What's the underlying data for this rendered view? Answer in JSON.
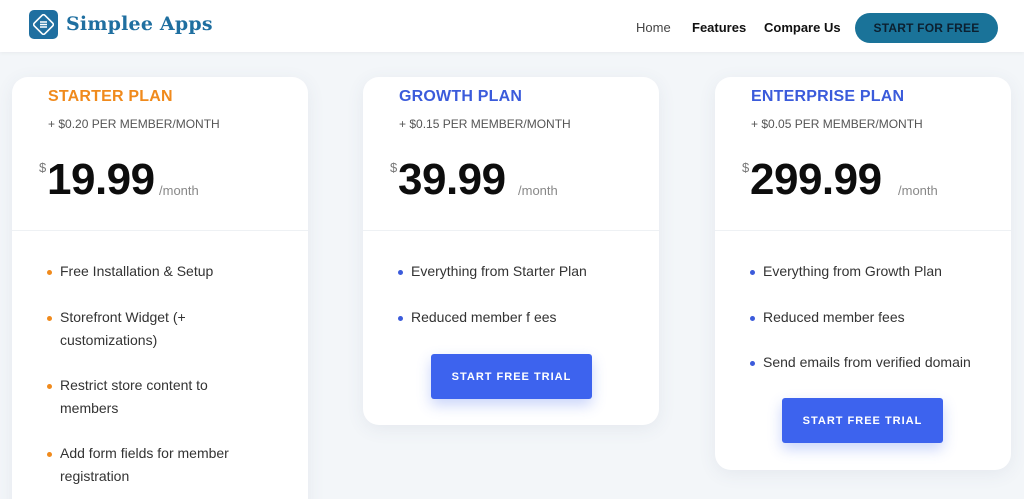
{
  "header": {
    "logo_text": "Simplee Apps",
    "nav": [
      "Home",
      "Features",
      "Compare Us"
    ],
    "cta_label": "START FOR FREE"
  },
  "plans": [
    {
      "name": "STARTER PLAN",
      "fee": "+ $0.20 PER MEMBER/MONTH",
      "currency": "$",
      "price": "19.99",
      "period": "/month",
      "features": [
        "Free Installation & Setup",
        "Storefront Widget (+",
        "customizations)",
        "Restrict store content to",
        "members",
        "Add form fields for member",
        "registration"
      ]
    },
    {
      "name": "GROWTH PLAN",
      "fee": "+ $0.15 PER MEMBER/MONTH",
      "currency": "$",
      "price": "39.99",
      "period": "/month",
      "features": [
        "Everything from Starter Plan",
        "Reduced member f ees"
      ],
      "cta_label": "START FREE TRIAL"
    },
    {
      "name": "ENTERPRISE PLAN",
      "fee": "+ $0.05 PER MEMBER/MONTH",
      "currency": "$",
      "price": "299.99",
      "period": "/month",
      "features": [
        "Everything from Growth Plan",
        "Reduced member fees",
        "Send emails from verified domain"
      ],
      "cta_label": "START FREE TRIAL"
    }
  ],
  "colors": {
    "brand": "#1f6fa0",
    "header_cta": "#1a7399",
    "starter_accent": "#f08a1c",
    "plan_accent": "#3b5bdb",
    "trial_button": "#3d63ee"
  }
}
